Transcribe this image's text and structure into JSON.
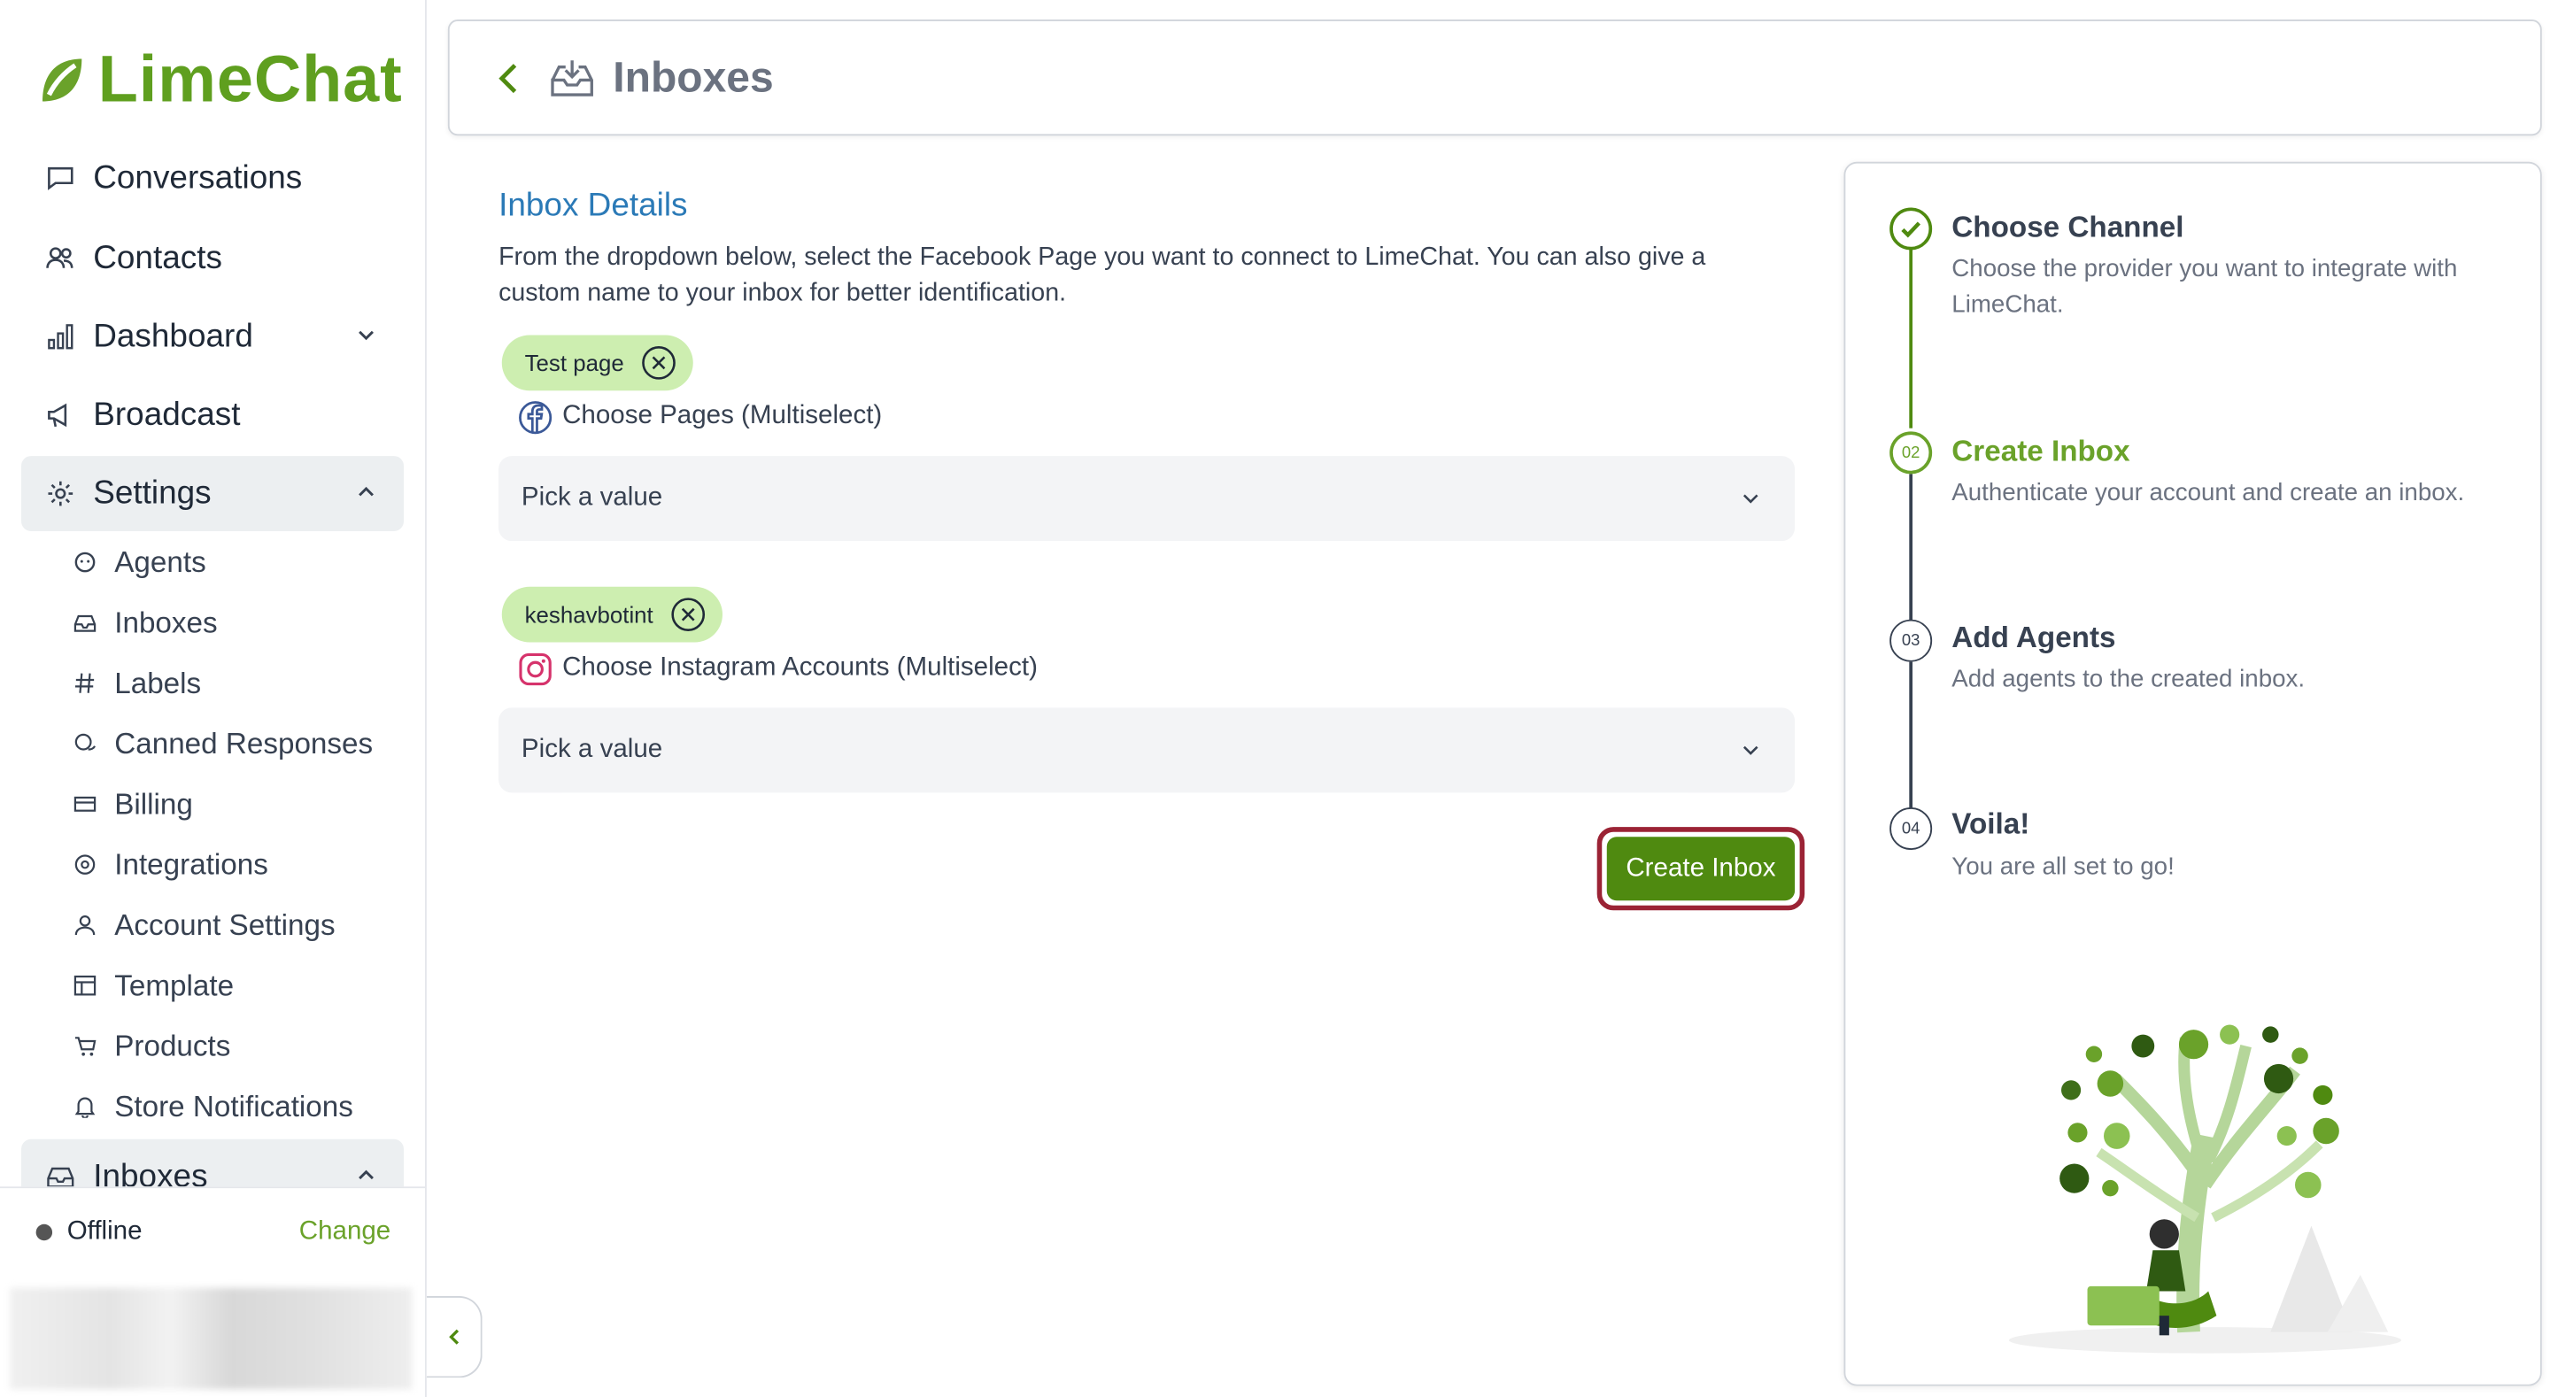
{
  "app": {
    "brand": "LimeChat",
    "brand_color": "#5f9f1f",
    "accent": "#4f8a10"
  },
  "sidebar": {
    "partial_top_label": "Conversations",
    "items": [
      {
        "label": "Contacts",
        "icon": "contacts-icon"
      },
      {
        "label": "Dashboard",
        "icon": "bar-chart-icon",
        "chevron": "chevron-down-icon"
      },
      {
        "label": "Broadcast",
        "icon": "megaphone-icon"
      },
      {
        "label": "Settings",
        "icon": "gear-icon",
        "chevron": "chevron-up-icon",
        "active": true
      }
    ],
    "settings_items": [
      {
        "label": "Agents",
        "icon": "agent-icon"
      },
      {
        "label": "Inboxes",
        "icon": "inbox-icon"
      },
      {
        "label": "Labels",
        "icon": "hashtag-icon"
      },
      {
        "label": "Canned Responses",
        "icon": "chat-bubbles-icon"
      },
      {
        "label": "Billing",
        "icon": "card-icon"
      },
      {
        "label": "Integrations",
        "icon": "integrations-icon"
      },
      {
        "label": "Account Settings",
        "icon": "user-icon"
      },
      {
        "label": "Template",
        "icon": "template-icon"
      },
      {
        "label": "Products",
        "icon": "cart-icon"
      },
      {
        "label": "Store Notifications",
        "icon": "bell-icon"
      }
    ],
    "partial_bottom_label": "Inboxes",
    "status": {
      "text": "Offline",
      "action": "Change"
    }
  },
  "header": {
    "title": "Inboxes"
  },
  "form": {
    "title": "Inbox Details",
    "description": "From the dropdown below, select the Facebook Page you want to connect to LimeChat. You can also give a custom name to your inbox for better identification.",
    "facebook": {
      "chip": "Test page",
      "label": "Choose Pages (Multiselect)",
      "placeholder": "Pick a value"
    },
    "instagram": {
      "chip": "keshavbotint",
      "label": "Choose Instagram Accounts (Multiselect)",
      "placeholder": "Pick a value"
    },
    "submit": "Create Inbox"
  },
  "steps": [
    {
      "marker": "check",
      "title": "Choose Channel",
      "desc": "Choose the provider you want to integrate with LimeChat.",
      "state": "done"
    },
    {
      "marker": "02",
      "title": "Create Inbox",
      "desc": "Authenticate your account and create an inbox.",
      "state": "current"
    },
    {
      "marker": "03",
      "title": "Add Agents",
      "desc": "Add agents to the created inbox.",
      "state": "todo"
    },
    {
      "marker": "04",
      "title": "Voila!",
      "desc": "You are all set to go!",
      "state": "todo"
    }
  ]
}
